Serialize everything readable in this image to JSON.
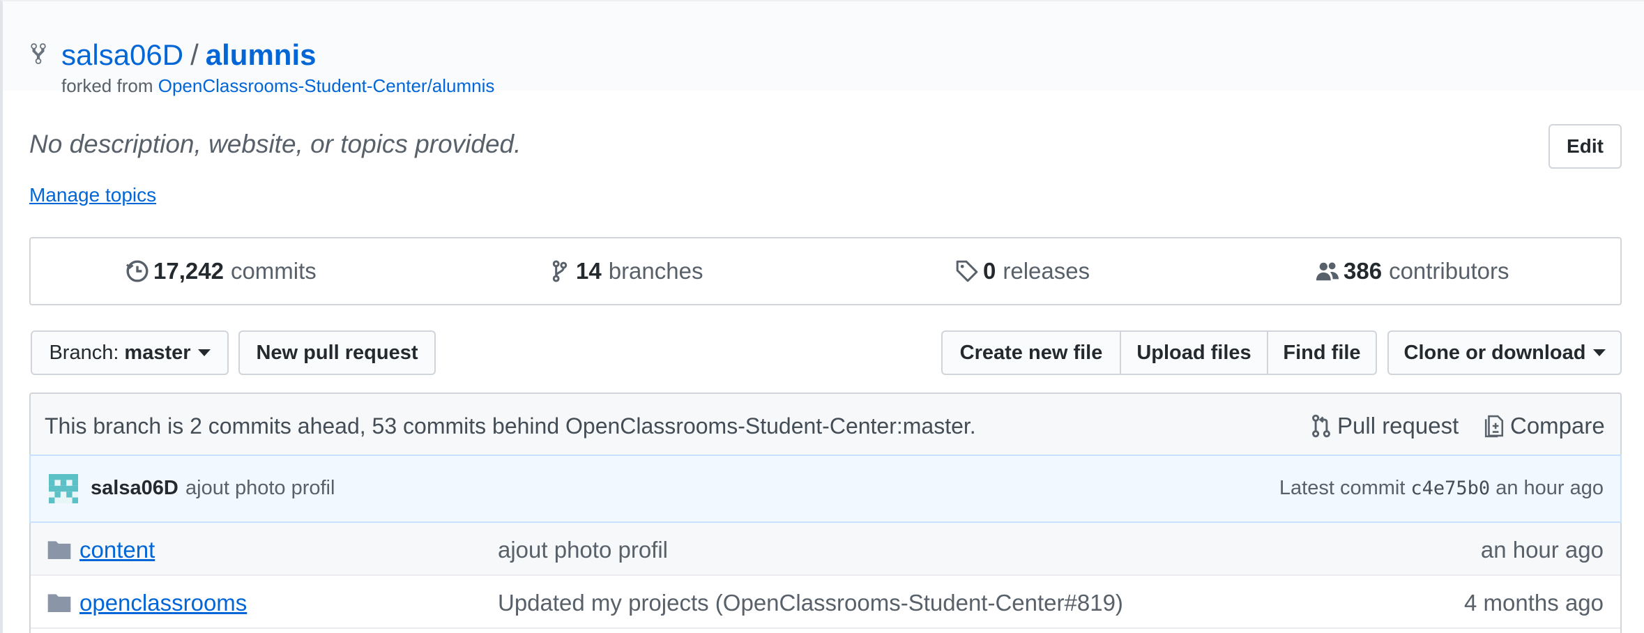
{
  "repo": {
    "owner": "salsa06D",
    "separator": "/",
    "name": "alumnis",
    "forked_prefix": "forked from",
    "forked_from": "OpenClassrooms-Student-Center/alumnis"
  },
  "about": {
    "description": "No description, website, or topics provided.",
    "edit_label": "Edit",
    "manage_topics": "Manage topics"
  },
  "numbers": {
    "commits": {
      "value": "17,242",
      "label": "commits",
      "icon": "history-icon"
    },
    "branches": {
      "value": "14",
      "label": "branches",
      "icon": "branch-icon"
    },
    "releases": {
      "value": "0",
      "label": "releases",
      "icon": "tag-icon"
    },
    "contributors": {
      "value": "386",
      "label": "contributors",
      "icon": "people-icon"
    }
  },
  "toolbar": {
    "branch_prefix": "Branch:",
    "branch_value": "master",
    "new_pull_request": "New pull request",
    "create_new_file": "Create new file",
    "upload_files": "Upload files",
    "find_file": "Find file",
    "clone_or_download": "Clone or download"
  },
  "compare": {
    "text": "This branch is 2 commits ahead, 53 commits behind OpenClassrooms-Student-Center:master.",
    "pull_request": "Pull request",
    "compare": "Compare"
  },
  "latest_commit": {
    "author": "salsa06D",
    "message": "ajout photo profil",
    "prefix": "Latest commit",
    "sha": "c4e75b0",
    "age": "an hour ago"
  },
  "files": [
    {
      "name": "content",
      "message": "ajout photo profil",
      "age": "an hour ago"
    },
    {
      "name": "openclassrooms",
      "message": "Updated my projects (OpenClassrooms-Student-Center#819)",
      "age": "4 months ago"
    }
  ],
  "colors": {
    "link": "#0366d6",
    "muted": "#586069",
    "border": "#d1d5da",
    "commit_bg": "#f1f8ff"
  }
}
